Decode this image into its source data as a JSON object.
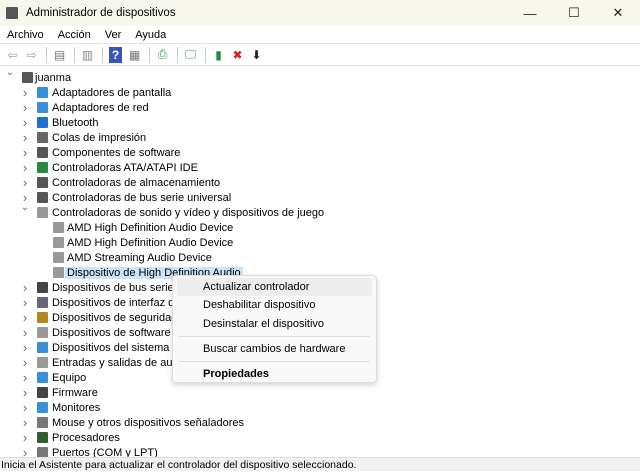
{
  "window": {
    "title": "Administrador de dispositivos",
    "minimize": "—",
    "maximize": "☐",
    "close": "✕"
  },
  "menu": [
    "Archivo",
    "Acción",
    "Ver",
    "Ayuda"
  ],
  "toolbar": [
    {
      "name": "back-icon",
      "glyph": "⇦",
      "color": "#999"
    },
    {
      "name": "forward-icon",
      "glyph": "⇨",
      "color": "#999"
    },
    {
      "sep": true
    },
    {
      "name": "show-hide-console-tree-icon",
      "glyph": "▤",
      "color": "#777"
    },
    {
      "sep": true
    },
    {
      "name": "properties-icon",
      "glyph": "▥",
      "color": "#888"
    },
    {
      "sep": true
    },
    {
      "name": "help-icon",
      "glyph": "?",
      "color": "#fff",
      "bg": "#3a55b8"
    },
    {
      "name": "action-pane-icon",
      "glyph": "▦",
      "color": "#777"
    },
    {
      "sep": true
    },
    {
      "name": "update-driver-icon",
      "glyph": "⎙",
      "color": "#2a9d3a"
    },
    {
      "sep": true
    },
    {
      "name": "scan-hardware-icon",
      "glyph": "🖵",
      "color": "#3a8fd6"
    },
    {
      "sep": true
    },
    {
      "name": "add-driver-icon",
      "glyph": "▮",
      "color": "#2a8a3a"
    },
    {
      "name": "uninstall-icon",
      "glyph": "✖",
      "color": "#e01818"
    },
    {
      "name": "download-icon",
      "glyph": "⬇",
      "color": "#222"
    }
  ],
  "tree": {
    "root": "juanma",
    "items": [
      {
        "label": "Adaptadores de pantalla",
        "color": "#3a8fd6"
      },
      {
        "label": "Adaptadores de red",
        "color": "#3a8fd6"
      },
      {
        "label": "Bluetooth",
        "color": "#1d6fd1"
      },
      {
        "label": "Colas de impresión",
        "color": "#666"
      },
      {
        "label": "Componentes de software",
        "color": "#555"
      },
      {
        "label": "Controladoras ATA/ATAPI IDE",
        "color": "#2a8a3a"
      },
      {
        "label": "Controladoras de almacenamiento",
        "color": "#555"
      },
      {
        "label": "Controladoras de bus serie universal",
        "color": "#555"
      },
      {
        "label": "Controladoras de sonido y vídeo y dispositivos de juego",
        "color": "#999",
        "expanded": true,
        "children": [
          "AMD High Definition Audio Device",
          "AMD High Definition Audio Device",
          "AMD Streaming Audio Device",
          "Dispositivo de High Definition Audio"
        ]
      },
      {
        "label": "Dispositivos de bus serie universal",
        "color": "#444"
      },
      {
        "label": "Dispositivos de interfaz de usuario",
        "color": "#667"
      },
      {
        "label": "Dispositivos de seguridad",
        "color": "#b08a20"
      },
      {
        "label": "Dispositivos de software",
        "color": "#999"
      },
      {
        "label": "Dispositivos del sistema",
        "color": "#3a8fd6"
      },
      {
        "label": "Entradas y salidas de audio",
        "color": "#999"
      },
      {
        "label": "Equipo",
        "color": "#3a8fd6"
      },
      {
        "label": "Firmware",
        "color": "#444"
      },
      {
        "label": "Monitores",
        "color": "#3a8fd6"
      },
      {
        "label": "Mouse y otros dispositivos señaladores",
        "color": "#777"
      },
      {
        "label": "Procesadores",
        "color": "#2f5f2f"
      },
      {
        "label": "Puertos (COM y LPT)",
        "color": "#777"
      }
    ],
    "selected_child": 3
  },
  "context_menu": {
    "items": [
      "Actualizar controlador",
      "Deshabilitar dispositivo",
      "Desinstalar el dispositivo",
      "Buscar cambios de hardware",
      "Propiedades"
    ]
  },
  "status": "Inicia el Asistente para actualizar el controlador del dispositivo seleccionado."
}
